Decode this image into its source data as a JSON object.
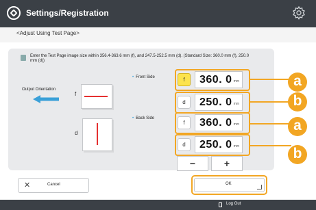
{
  "header": {
    "title": "Settings/Registration"
  },
  "subheader": {
    "text": "<Adjust Using Test Page>"
  },
  "instructions": "Enter the Test Page image size within 356.4-363.6 mm (f), and 247.5-252.5 mm (d). (Standard Size: 360.0 mm (f), 250.0 mm (d))",
  "output_orientation_label": "Output Orientation",
  "diagram": {
    "f_label": "f",
    "d_label": "d"
  },
  "front_side": {
    "label": "Front Side",
    "rows": [
      {
        "key": "f",
        "value": "360. 0",
        "unit": "mm",
        "active": true
      },
      {
        "key": "d",
        "value": "250. 0",
        "unit": "mm",
        "active": false
      }
    ]
  },
  "back_side": {
    "label": "Back Side",
    "rows": [
      {
        "key": "f",
        "value": "360. 0",
        "unit": "mm",
        "active": false
      },
      {
        "key": "d",
        "value": "250. 0",
        "unit": "mm",
        "active": false
      }
    ]
  },
  "stepper": {
    "minus": "−",
    "plus": "+"
  },
  "callouts": {
    "a": "a",
    "b": "b"
  },
  "buttons": {
    "cancel_icon": "✕",
    "cancel": "Cancel",
    "ok": "OK"
  },
  "footer": {
    "logout": "Log Out"
  },
  "colors": {
    "titlebar": "#3b4046",
    "accent_orange": "#f2a623",
    "active_key": "#fce34d",
    "arrow": "#3aa0d8",
    "guide_line": "#e53030"
  }
}
